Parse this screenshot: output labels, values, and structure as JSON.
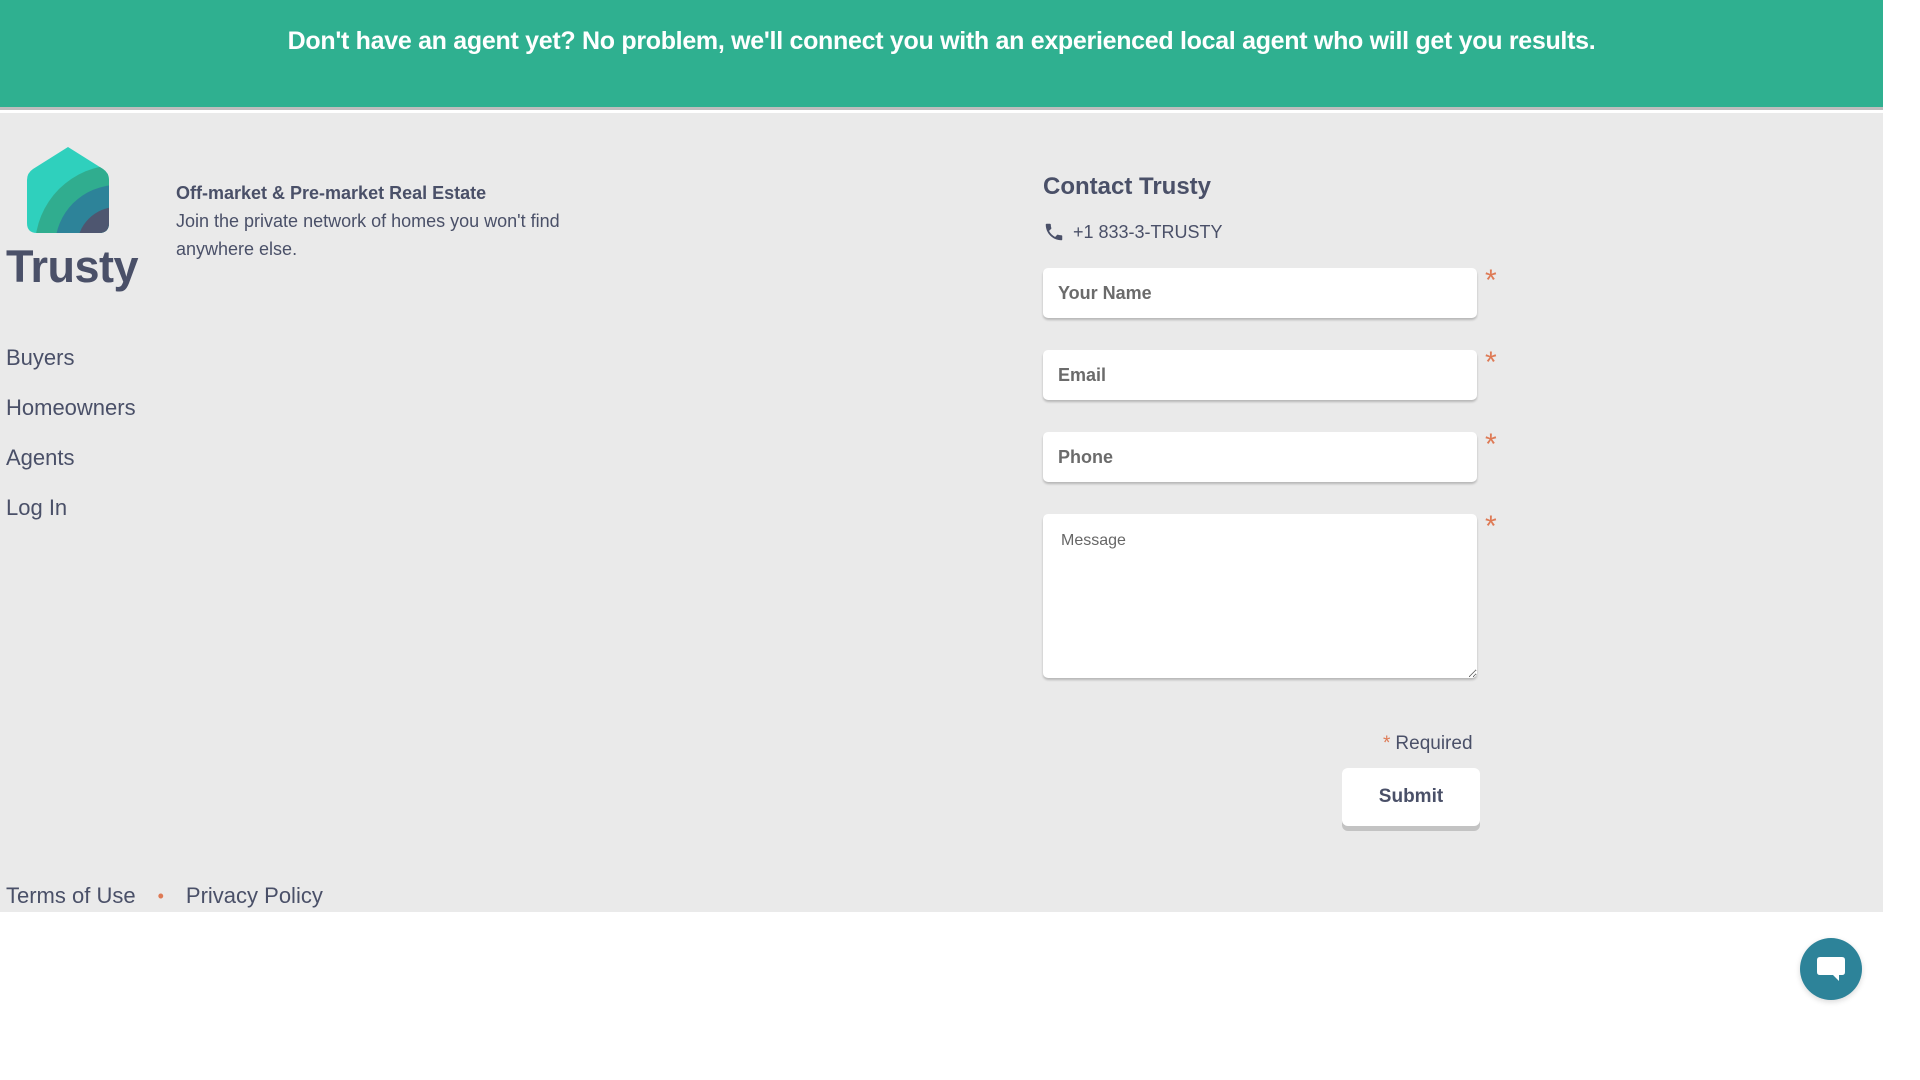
{
  "banner": {
    "text": "Don't have an agent yet? No problem, we'll connect you with an experienced local agent who will get you results."
  },
  "brand": {
    "name": "Trusty",
    "logo_icon": "house-logo-icon",
    "colors": {
      "teal_light": "#2fd0bd",
      "green": "#30ad8f",
      "blue": "#2d8399",
      "slate": "#4e5670"
    }
  },
  "tagline": {
    "title": "Off-market & Pre-market Real Estate",
    "body": "Join the private network of homes you won't find anywhere else."
  },
  "nav": {
    "items": [
      {
        "label": "Buyers"
      },
      {
        "label": "Homeowners"
      },
      {
        "label": "Agents"
      },
      {
        "label": "Log In"
      }
    ]
  },
  "contact": {
    "title": "Contact Trusty",
    "phone_icon": "phone-icon",
    "phone": "+1 833-3-TRUSTY",
    "fields": {
      "name": {
        "placeholder": "Your Name",
        "value": ""
      },
      "email": {
        "placeholder": "Email",
        "value": ""
      },
      "phone": {
        "placeholder": "Phone",
        "value": ""
      },
      "message": {
        "placeholder": "Message",
        "value": ""
      }
    },
    "required_marker": "*",
    "required_label": "Required",
    "submit_label": "Submit"
  },
  "legal": {
    "terms": "Terms of Use",
    "separator": "•",
    "privacy": "Privacy Policy"
  },
  "chat": {
    "icon": "chat-bubble-icon"
  },
  "colors": {
    "banner_bg": "#2fb090",
    "footer_bg": "#eaeaea",
    "text": "#4a5068",
    "accent": "#de7a55",
    "chat_bg": "#2d8399"
  }
}
